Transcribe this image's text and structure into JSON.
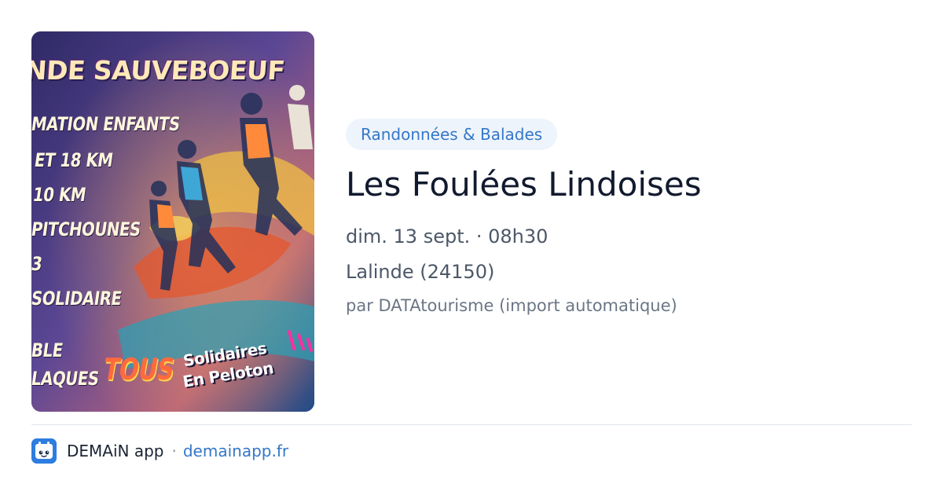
{
  "poster": {
    "title": "NDE SAUVEBOEUF",
    "lines": [
      "MATION ENFANTS",
      "ET 18 KM",
      "10 KM",
      "PITCHOUNES",
      "3",
      "SOLIDAIRE",
      "BLE",
      "LAQUES"
    ],
    "tous": "TOUS",
    "solidaires_line1": "Solidaires",
    "solidaires_line2": "En Peloton"
  },
  "event": {
    "category": "Randonnées & Balades",
    "title": "Les Foulées Lindoises",
    "date": "dim. 13 sept. · 08h30",
    "location": "Lalinde (24150)",
    "source": "par DATAtourisme (import automatique)"
  },
  "footer": {
    "app_name": "DEMAiN app",
    "separator": "·",
    "url": "demainapp.fr",
    "icon": "app-logo-icon"
  },
  "colors": {
    "accent": "#3477c8",
    "badge_bg": "#eef4fb",
    "title": "#111a2e",
    "meta": "#4c5868",
    "source": "#6b7685",
    "divider": "#dfe4ea"
  }
}
